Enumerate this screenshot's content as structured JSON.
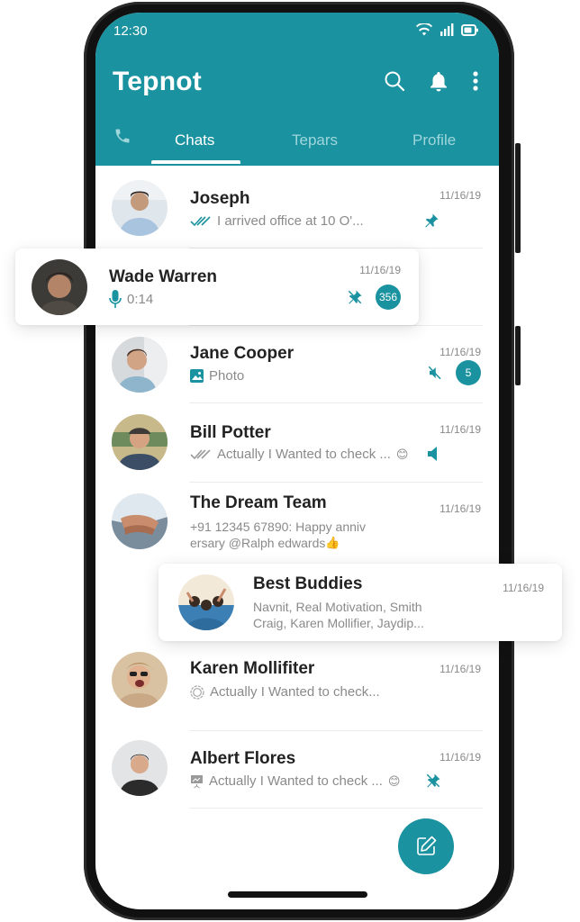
{
  "status_bar": {
    "time": "12:30",
    "icons": [
      "wifi-icon",
      "signal-icon",
      "battery-icon"
    ]
  },
  "app": {
    "title": "Tepnot"
  },
  "top_actions": [
    "search-icon",
    "bell-icon",
    "more-vertical-icon"
  ],
  "tabs": [
    {
      "icon": "phone-icon",
      "label": ""
    },
    {
      "label": "Chats",
      "active": true
    },
    {
      "label": "Tepars",
      "active": false
    },
    {
      "label": "Profile",
      "active": false
    }
  ],
  "theme": {
    "accent": "#1b929f",
    "tab_inactive": "#9fd6dc",
    "text_primary": "#222222",
    "text_secondary": "#8a8a8a"
  },
  "chats": [
    {
      "name": "Joseph",
      "message": "I arrived office at 10 O'...",
      "date": "11/16/19",
      "status_icon": "double-check-icon",
      "status_icon_color": "#1b929f",
      "pinned": true
    },
    {
      "name": "Wade Warren",
      "message": "0:14",
      "date": "11/16/19",
      "status_icon": "microphone-icon",
      "unpinned": true,
      "unread": "356",
      "elevated": true
    },
    {
      "name": "Jane Cooper",
      "message": "Photo",
      "date": "11/16/19",
      "status_icon": "image-icon",
      "muted": true,
      "unread": "5"
    },
    {
      "name": "Bill Potter",
      "message": "Actually I Wanted to check ...",
      "emoji": "😊",
      "date": "11/16/19",
      "status_icon": "double-check-icon",
      "status_icon_color": "#9a9a9a",
      "sound": true
    },
    {
      "name": "The Dream Team",
      "message_line1": "+91 12345 67890: Happy anniv",
      "message_line2": "ersary @Ralph edwards",
      "emoji": "👍",
      "date": "11/16/19"
    },
    {
      "name": "Best Buddies",
      "message_line1": "Navnit, Real Motivation, Smith",
      "message_line2": "Craig, Karen Mollifier, Jaydip...",
      "date": "11/16/19",
      "elevated": true
    },
    {
      "name": "Karen Mollifiter",
      "message": "Actually I Wanted to check...",
      "date": "11/16/19",
      "status_icon": "circle-status-icon"
    },
    {
      "name": "Albert Flores",
      "message": "Actually I Wanted to check ...",
      "emoji": "😊",
      "date": "11/16/19",
      "status_icon": "presentation-icon",
      "unpinned": true
    }
  ],
  "fab": {
    "icon": "compose-icon"
  }
}
